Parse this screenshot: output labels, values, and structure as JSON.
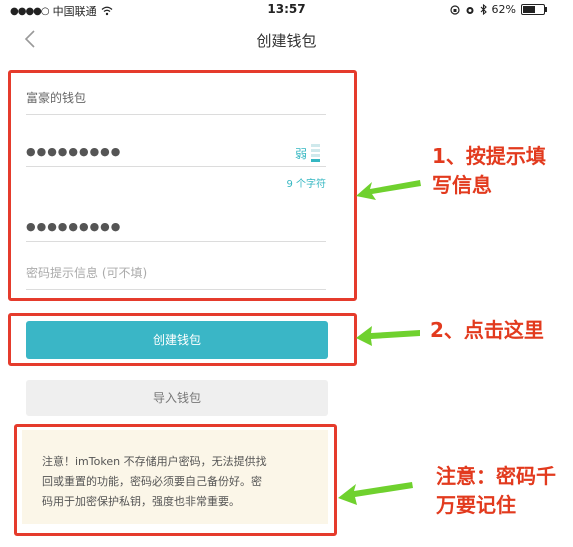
{
  "status_bar": {
    "signal_dots": "●●●●○",
    "carrier": "中国联通",
    "wifi_icon": "wifi-icon",
    "time": "13:57",
    "battery_percent": "62%",
    "battery_level": 0.62
  },
  "nav": {
    "title": "创建钱包",
    "back_icon": "chevron-left-icon"
  },
  "form": {
    "wallet_name": "富豪的钱包",
    "password_masked": "●●●●●●●●●",
    "strength_label": "弱",
    "char_count": "9 个字符",
    "repeat_password_masked": "●●●●●●●●●",
    "hint_placeholder": "密码提示信息 (可不填)"
  },
  "buttons": {
    "create": "创建钱包",
    "import": "导入钱包"
  },
  "notice": {
    "line1": "注意！imToken 不存储用户密码，无法提供找",
    "line2": "回或重置的功能，密码必须要自己备份好。密",
    "line3": "码用于加密保护私钥，强度也非常重要。"
  },
  "annotations": {
    "step1_line1": "1、按提示填",
    "step1_line2": "写信息",
    "step2": "2、点击这里",
    "note_line1": "注意：密码千",
    "note_line2": "万要记住"
  },
  "colors": {
    "accent": "#3ab6c6",
    "annotation_red": "#e53b2c",
    "arrow_green": "#6fd12e",
    "notice_bg": "#fbf6e8"
  }
}
